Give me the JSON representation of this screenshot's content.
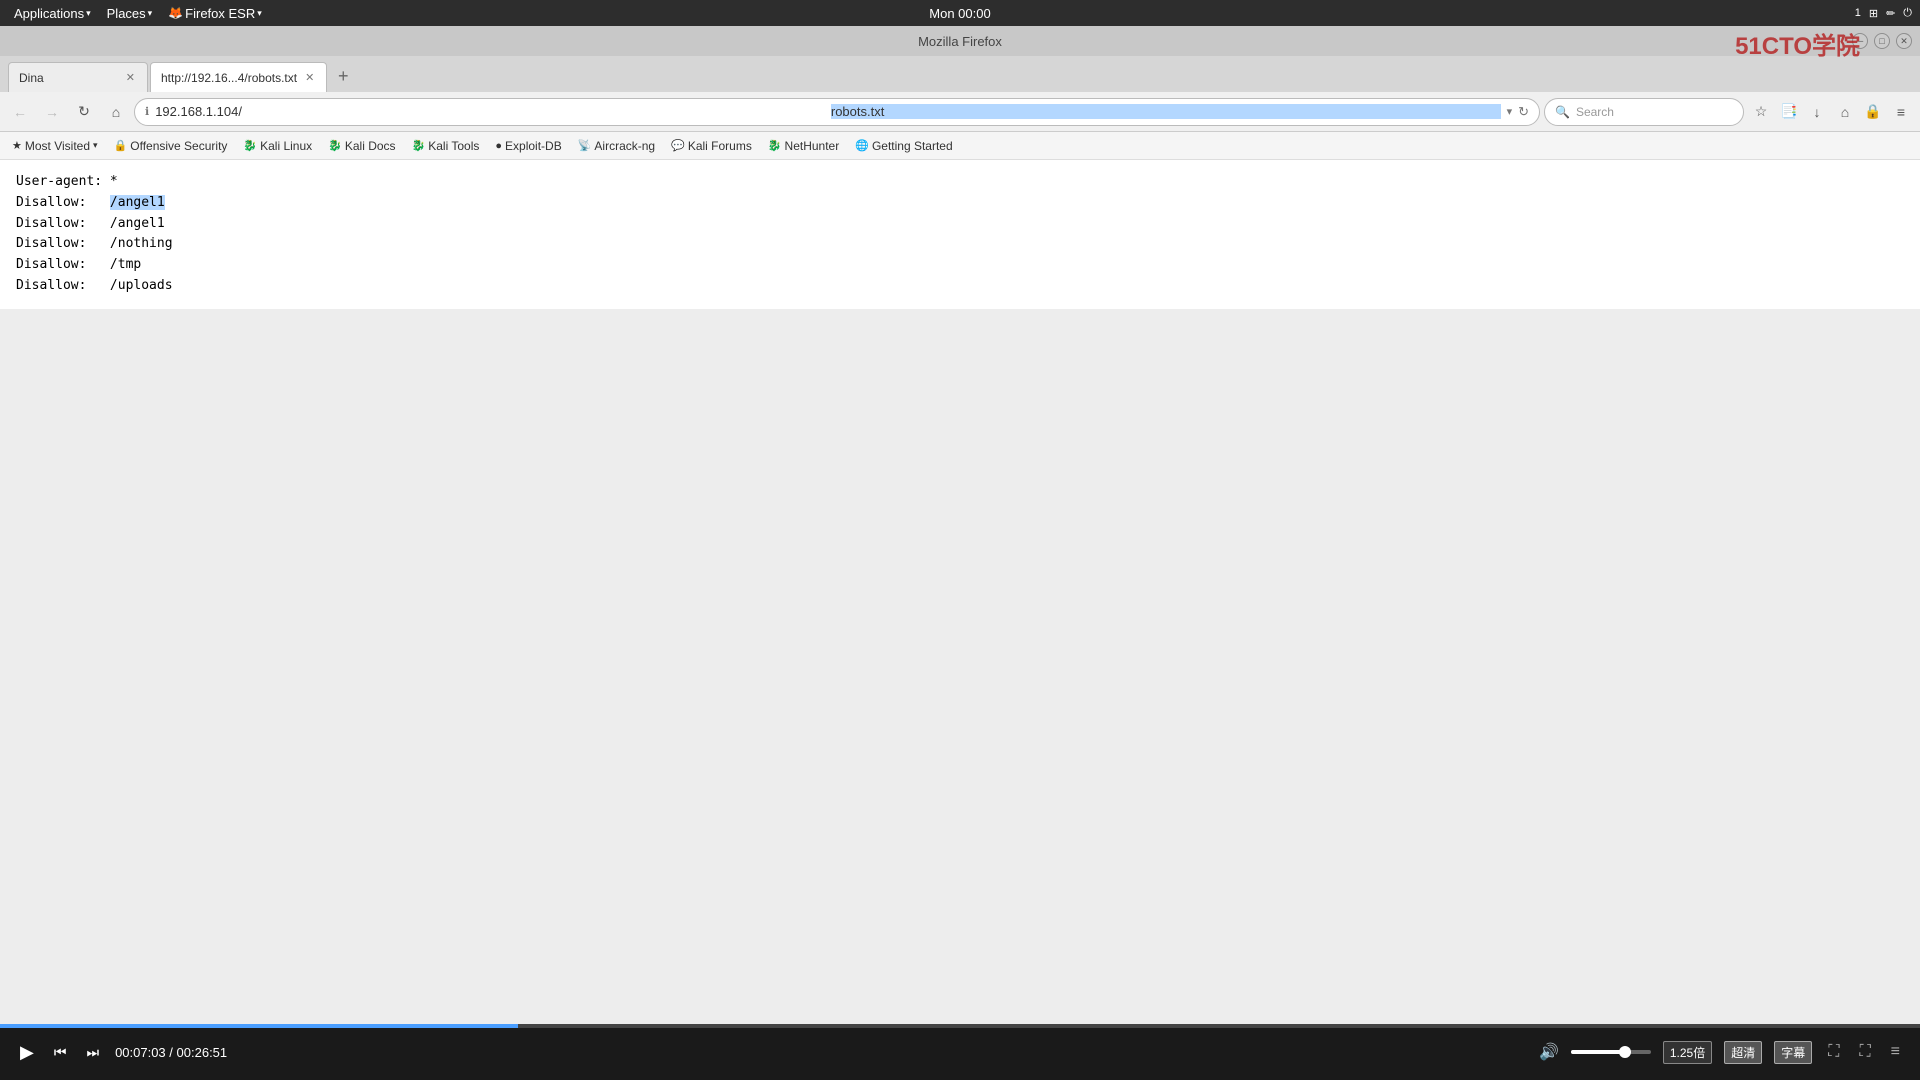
{
  "system_bar": {
    "applications": "Applications",
    "places": "Places",
    "browser": "Firefox ESR",
    "time": "Mon 00:00",
    "watermark": "51CTO学院"
  },
  "firefox": {
    "title": "Mozilla Firefox",
    "tabs": [
      {
        "id": "tab1",
        "label": "Dina",
        "active": false
      },
      {
        "id": "tab2",
        "label": "http://192.16...4/robots.txt",
        "active": true
      }
    ],
    "new_tab_symbol": "+"
  },
  "navbar": {
    "back_arrow": "←",
    "forward_arrow": "→",
    "reload": "↻",
    "home": "⌂",
    "url": "192.168.1.104/",
    "url_highlight": "robots.txt",
    "search_placeholder": "Search",
    "star_icon": "☆",
    "bookmark_icon": "📎",
    "download_icon": "↓",
    "home_icon": "⌂",
    "sync_icon": "🔒",
    "menu_icon": "≡"
  },
  "bookmarks": [
    {
      "label": "Most Visited",
      "icon": "★",
      "has_arrow": true
    },
    {
      "label": "Offensive Security",
      "icon": "🔒"
    },
    {
      "label": "Kali Linux",
      "icon": "🐉"
    },
    {
      "label": "Kali Docs",
      "icon": "🐉"
    },
    {
      "label": "Kali Tools",
      "icon": "🐉"
    },
    {
      "label": "Exploit-DB",
      "icon": "●"
    },
    {
      "label": "Aircrack-ng",
      "icon": "📡"
    },
    {
      "label": "Kali Forums",
      "icon": "💬"
    },
    {
      "label": "NetHunter",
      "icon": "🐉"
    },
    {
      "label": "Getting Started",
      "icon": "🌐"
    }
  ],
  "page_content": {
    "lines": [
      {
        "key": "User-agent:",
        "value": "*",
        "highlight": false
      },
      {
        "key": "Disallow:",
        "value": "/angel1",
        "highlight": true
      },
      {
        "key": "Disallow:",
        "value": "/angel1",
        "highlight": false
      },
      {
        "key": "Disallow:",
        "value": "/nothing",
        "highlight": false
      },
      {
        "key": "Disallow:",
        "value": "/tmp",
        "highlight": false
      },
      {
        "key": "Disallow:",
        "value": "/uploads",
        "highlight": false
      }
    ]
  },
  "video_player": {
    "play_icon": "▶",
    "prev_icon": "⏮",
    "next_icon": "⏭",
    "time_current": "00:07:03",
    "time_total": "00:26:51",
    "volume_icon": "🔊",
    "speed_badge": "1.25倍",
    "hd_badge": "超清",
    "subtitle_badge": "字幕",
    "settings_icon": "⛶",
    "menu_icon": "≡",
    "progress_percent": 27
  }
}
